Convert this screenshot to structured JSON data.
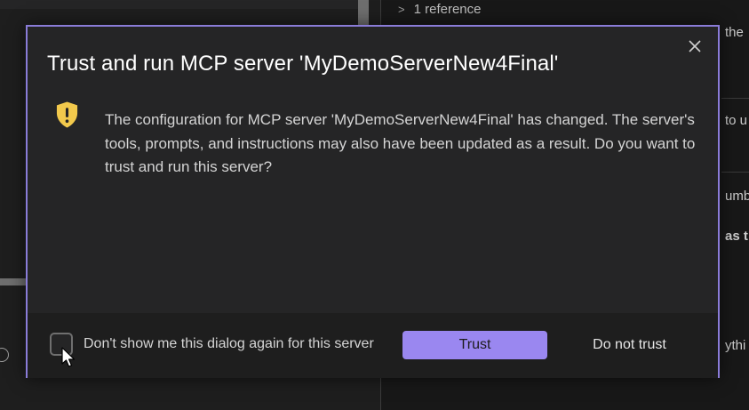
{
  "background": {
    "reference_chevron": ">",
    "reference_text": "1 reference",
    "fragments": [
      "the",
      "to u",
      "umb",
      "as t",
      "ythi"
    ]
  },
  "dialog": {
    "title": "Trust and run MCP server 'MyDemoServerNew4Final'",
    "icon": "shield-warning-icon",
    "message": "The configuration for MCP server 'MyDemoServerNew4Final' has changed. The server's tools, prompts, and instructions may also have been updated as a result. Do you want to trust and run this server?",
    "checkbox_label": "Don't show me this dialog again for this server",
    "checkbox_checked": false,
    "trust_label": "Trust",
    "do_not_trust_label": "Do not trust",
    "colors": {
      "accent_border": "#8a7cd8",
      "primary_button": "#9a87f0",
      "warning_icon": "#f2c94c"
    }
  }
}
